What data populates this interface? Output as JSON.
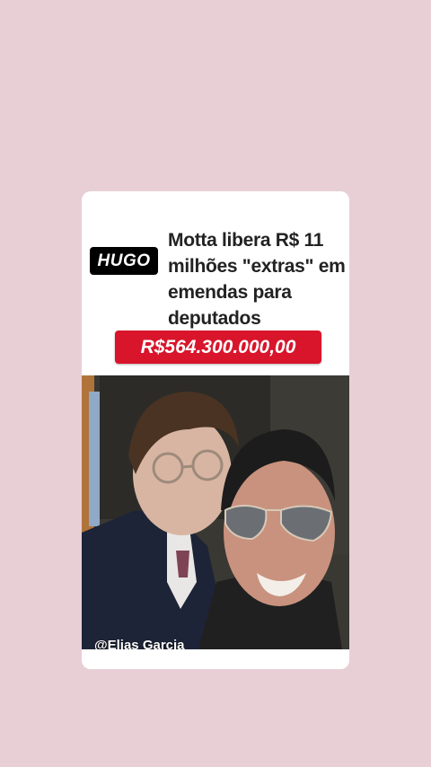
{
  "card": {
    "badge_text": "HUGO",
    "headline": "Motta libera R$ 11 milhões \"extras\" em emendas para deputados",
    "amount": "R$564.300.000,00",
    "image_alt": "photo of two men",
    "credit": "@Elias Garcia"
  },
  "colors": {
    "background": "#e8cfd6",
    "accent_red": "#d8152b",
    "badge_black": "#000000"
  }
}
